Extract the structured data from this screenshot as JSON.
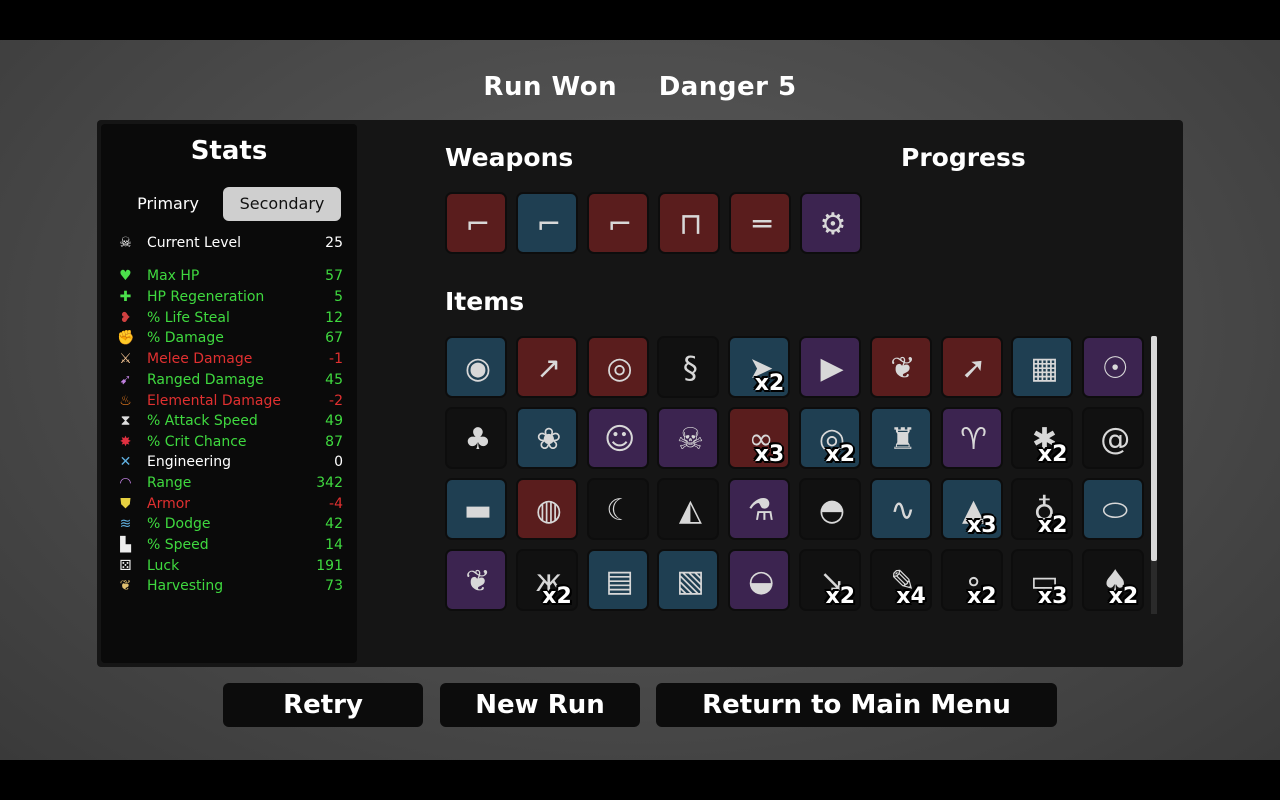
{
  "header": {
    "result": "Run Won",
    "danger": "Danger 5"
  },
  "stats": {
    "title": "Stats",
    "tabs": {
      "primary": "Primary",
      "secondary": "Secondary"
    },
    "current_level": {
      "label": "Current Level",
      "value": "25",
      "icon": "skull-icon",
      "color": "#ffffff"
    },
    "rows": [
      {
        "label": "Max HP",
        "value": "57",
        "color": "#3fd93f",
        "icon": "heart-icon",
        "glyph": "♥",
        "icolor": "#4be04b"
      },
      {
        "label": "HP Regeneration",
        "value": "5",
        "color": "#3fd93f",
        "icon": "heart-plus-icon",
        "glyph": "✚",
        "icolor": "#4be04b"
      },
      {
        "label": "% Life Steal",
        "value": "12",
        "color": "#3fd93f",
        "icon": "fangs-icon",
        "glyph": "❥",
        "icolor": "#d04040"
      },
      {
        "label": "% Damage",
        "value": "67",
        "color": "#3fd93f",
        "icon": "muscle-icon",
        "glyph": "✊",
        "icolor": "#e46a6a"
      },
      {
        "label": "Melee Damage",
        "value": "-1",
        "color": "#e03030",
        "icon": "sword-icon",
        "glyph": "⚔",
        "icolor": "#f0c090"
      },
      {
        "label": "Ranged Damage",
        "value": "45",
        "color": "#3fd93f",
        "icon": "bow-icon",
        "glyph": "➹",
        "icolor": "#c080e0"
      },
      {
        "label": "Elemental Damage",
        "value": "-2",
        "color": "#e03030",
        "icon": "flame-icon",
        "glyph": "♨",
        "icolor": "#f08020"
      },
      {
        "label": "% Attack Speed",
        "value": "49",
        "color": "#3fd93f",
        "icon": "hourglass-icon",
        "glyph": "⧗",
        "icolor": "#dddddd"
      },
      {
        "label": "% Crit Chance",
        "value": "87",
        "color": "#3fd93f",
        "icon": "crit-burst-icon",
        "glyph": "✸",
        "icolor": "#e03040"
      },
      {
        "label": "Engineering",
        "value": "0",
        "color": "#ffffff",
        "icon": "wrench-icon",
        "glyph": "✕",
        "icolor": "#60b0e0"
      },
      {
        "label": "Range",
        "value": "342",
        "color": "#3fd93f",
        "icon": "wifi-icon",
        "glyph": "◠",
        "icolor": "#c080e0"
      },
      {
        "label": "Armor",
        "value": "-4",
        "color": "#e03030",
        "icon": "shield-icon",
        "glyph": "⛊",
        "icolor": "#e6d040"
      },
      {
        "label": "% Dodge",
        "value": "42",
        "color": "#3fd93f",
        "icon": "dash-icon",
        "glyph": "≋",
        "icolor": "#60b0e0"
      },
      {
        "label": "% Speed",
        "value": "14",
        "color": "#3fd93f",
        "icon": "boot-icon",
        "glyph": "▙",
        "icolor": "#eeeeee"
      },
      {
        "label": "Luck",
        "value": "191",
        "color": "#3fd93f",
        "icon": "dice-icon",
        "glyph": "⚄",
        "icolor": "#eeeeee"
      },
      {
        "label": "Harvesting",
        "value": "73",
        "color": "#3fd93f",
        "icon": "wheat-icon",
        "glyph": "❦",
        "icolor": "#e0c070"
      }
    ]
  },
  "sections": {
    "weapons": "Weapons",
    "progress": "Progress",
    "items": "Items"
  },
  "weapons": [
    {
      "icon": "revolver-icon",
      "tier": "red",
      "glyph": "⌐"
    },
    {
      "icon": "revolver-icon",
      "tier": "blue",
      "glyph": "⌐"
    },
    {
      "icon": "revolver-icon",
      "tier": "red",
      "glyph": "⌐"
    },
    {
      "icon": "smg-icon",
      "tier": "red",
      "glyph": "⊓"
    },
    {
      "icon": "shotgun-icon",
      "tier": "red",
      "glyph": "═"
    },
    {
      "icon": "minigun-icon",
      "tier": "purple",
      "glyph": "⚙"
    }
  ],
  "items": [
    {
      "icon": "egg-icon",
      "tier": "blue",
      "glyph": "◉",
      "count": ""
    },
    {
      "icon": "spear-icon",
      "tier": "red",
      "glyph": "↗",
      "count": ""
    },
    {
      "icon": "belt-icon",
      "tier": "red",
      "glyph": "◎",
      "count": ""
    },
    {
      "icon": "alien-worm-icon",
      "tier": "black",
      "glyph": "§",
      "count": ""
    },
    {
      "icon": "bullet-icon",
      "tier": "blue",
      "glyph": "➤",
      "count": "x2"
    },
    {
      "icon": "triangle-gem-icon",
      "tier": "purple",
      "glyph": "▶",
      "count": ""
    },
    {
      "icon": "stomach-icon",
      "tier": "red",
      "glyph": "❦",
      "count": ""
    },
    {
      "icon": "shell-icon",
      "tier": "red",
      "glyph": "➚",
      "count": ""
    },
    {
      "icon": "vest-icon",
      "tier": "blue",
      "glyph": "▦",
      "count": ""
    },
    {
      "icon": "alien-eye-icon",
      "tier": "purple",
      "glyph": "☉",
      "count": ""
    },
    {
      "icon": "tree-icon",
      "tier": "black",
      "glyph": "♣",
      "count": ""
    },
    {
      "icon": "bush-icon",
      "tier": "blue",
      "glyph": "❀",
      "count": ""
    },
    {
      "icon": "ghost-icon",
      "tier": "purple",
      "glyph": "☺",
      "count": ""
    },
    {
      "icon": "voodoo-doll-icon",
      "tier": "purple",
      "glyph": "☠",
      "count": ""
    },
    {
      "icon": "binoculars-icon",
      "tier": "red",
      "glyph": "∞",
      "count": "x3"
    },
    {
      "icon": "target-icon",
      "tier": "blue",
      "glyph": "◎",
      "count": "x2"
    },
    {
      "icon": "ketchup-icon",
      "tier": "blue",
      "glyph": "♜",
      "count": ""
    },
    {
      "icon": "horned-beast-icon",
      "tier": "purple",
      "glyph": "♈",
      "count": ""
    },
    {
      "icon": "bug-icon",
      "tier": "black",
      "glyph": "✱",
      "count": "x2"
    },
    {
      "icon": "snail-icon",
      "tier": "black",
      "glyph": "@",
      "count": ""
    },
    {
      "icon": "scarf-icon",
      "tier": "blue",
      "glyph": "▬",
      "count": ""
    },
    {
      "icon": "coin-icon",
      "tier": "red",
      "glyph": "◍",
      "count": ""
    },
    {
      "icon": "crescent-icon",
      "tier": "black",
      "glyph": "☾",
      "count": ""
    },
    {
      "icon": "cake-icon",
      "tier": "black",
      "glyph": "◭",
      "count": ""
    },
    {
      "icon": "potion-icon",
      "tier": "purple",
      "glyph": "⚗",
      "count": ""
    },
    {
      "icon": "propeller-hat-icon",
      "tier": "black",
      "glyph": "◓",
      "count": ""
    },
    {
      "icon": "tentacle-icon",
      "tier": "blue",
      "glyph": "∿",
      "count": ""
    },
    {
      "icon": "claw-icon",
      "tier": "blue",
      "glyph": "▲",
      "count": "x3"
    },
    {
      "icon": "sack-icon",
      "tier": "black",
      "glyph": "♁",
      "count": "x2"
    },
    {
      "icon": "fish-icon",
      "tier": "blue",
      "glyph": "⬭",
      "count": ""
    },
    {
      "icon": "wings-icon",
      "tier": "purple",
      "glyph": "❦",
      "count": ""
    },
    {
      "icon": "butterfly-icon",
      "tier": "black",
      "glyph": "ж",
      "count": "x2"
    },
    {
      "icon": "cash-register-icon",
      "tier": "blue",
      "glyph": "▤",
      "count": ""
    },
    {
      "icon": "armor-plate-icon",
      "tier": "blue",
      "glyph": "▧",
      "count": ""
    },
    {
      "icon": "bowler-hat-icon",
      "tier": "purple",
      "glyph": "◒",
      "count": ""
    },
    {
      "icon": "arrow-icon",
      "tier": "black",
      "glyph": "↘",
      "count": "x2"
    },
    {
      "icon": "bandage-icon",
      "tier": "black",
      "glyph": "✎",
      "count": "x4"
    },
    {
      "icon": "pebbles-icon",
      "tier": "black",
      "glyph": "∘",
      "count": "x2"
    },
    {
      "icon": "banknote-icon",
      "tier": "black",
      "glyph": "▭",
      "count": "x3"
    },
    {
      "icon": "mushroom-icon",
      "tier": "black",
      "glyph": "♠",
      "count": "x2"
    }
  ],
  "buttons": {
    "retry": "Retry",
    "new_run": "New Run",
    "main_menu": "Return to Main Menu"
  }
}
